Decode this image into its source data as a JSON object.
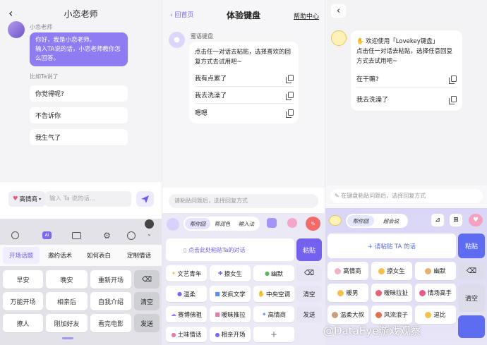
{
  "panel1": {
    "title": "小恋老师",
    "bot_name": "小恋老师",
    "bot_message": "你好，我是小恋老师。\n输入TA说的话，小恋老师教你怎么回答。",
    "prompt_label": "比如Ta说了",
    "suggestions": [
      "你觉得呢?",
      "不告诉你",
      "我生气了"
    ],
    "mode_select": "高情商",
    "input_placeholder": "输入 Ta 说的话...",
    "keyboard_tabs": [
      "开场话题",
      "邀约话术",
      "如何表白",
      "定制情话"
    ],
    "keys": [
      [
        "早安",
        "晚安",
        "重新开场"
      ],
      [
        "万能开场",
        "相亲后",
        "自我介绍"
      ],
      [
        "撩人",
        "刚加好友",
        "看完电影"
      ]
    ],
    "side_keys": [
      "清空",
      "发送"
    ]
  },
  "panel2": {
    "back_label": "回首页",
    "title": "体验键盘",
    "help_label": "帮助中心",
    "bot_name": "蜜语键盘",
    "intro": "点击任一对话去粘贴，选择喜欢的回复方式去试用吧~",
    "samples": [
      "我有点累了",
      "我去洗澡了",
      "嗯嗯"
    ],
    "input_placeholder": "请粘贴问题后，选择回复方式",
    "toolbar_tabs": [
      "帮你回",
      "帮润色",
      "输入法"
    ],
    "paste_hint": "点击此处粘贴Ta的对话",
    "paste_button": "粘贴",
    "keys": [
      [
        "文艺青年",
        "撩女生",
        "幽默"
      ],
      [
        "温柔",
        "发疯文学",
        "中央空调"
      ],
      [
        "赛博佛祖",
        "暧昧推拉",
        "高情商"
      ],
      [
        "土味情话",
        "相亲开场",
        "+"
      ]
    ],
    "side_keys": [
      "清空",
      "发送"
    ]
  },
  "panel3": {
    "welcome": "欢迎使用「Lovekey键盘」",
    "intro": "点击任一对话去粘贴，选择任意回复方式去试用吧~",
    "samples": [
      "在干嘛?",
      "我去洗澡了"
    ],
    "input_placeholder": "在键盘粘贴问题后，选择回复方式",
    "toolbar_tabs": [
      "帮你回",
      "超会说"
    ],
    "paste_hint": "+ 请粘贴 TA 的话",
    "paste_button": "粘贴",
    "keys": [
      [
        "高情商",
        "撩女生",
        "幽默"
      ],
      [
        "暖男",
        "暧昧拉扯",
        "情场高手"
      ],
      [
        "温柔大叔",
        "风流浪子",
        "逗比"
      ]
    ],
    "side_keys": [
      "清空"
    ],
    "watermark": "@DataEye游戏观察"
  },
  "colors": {
    "accent": "#7d67f0",
    "bubble": "#8f7cf2",
    "send": "#6e5cf0"
  }
}
